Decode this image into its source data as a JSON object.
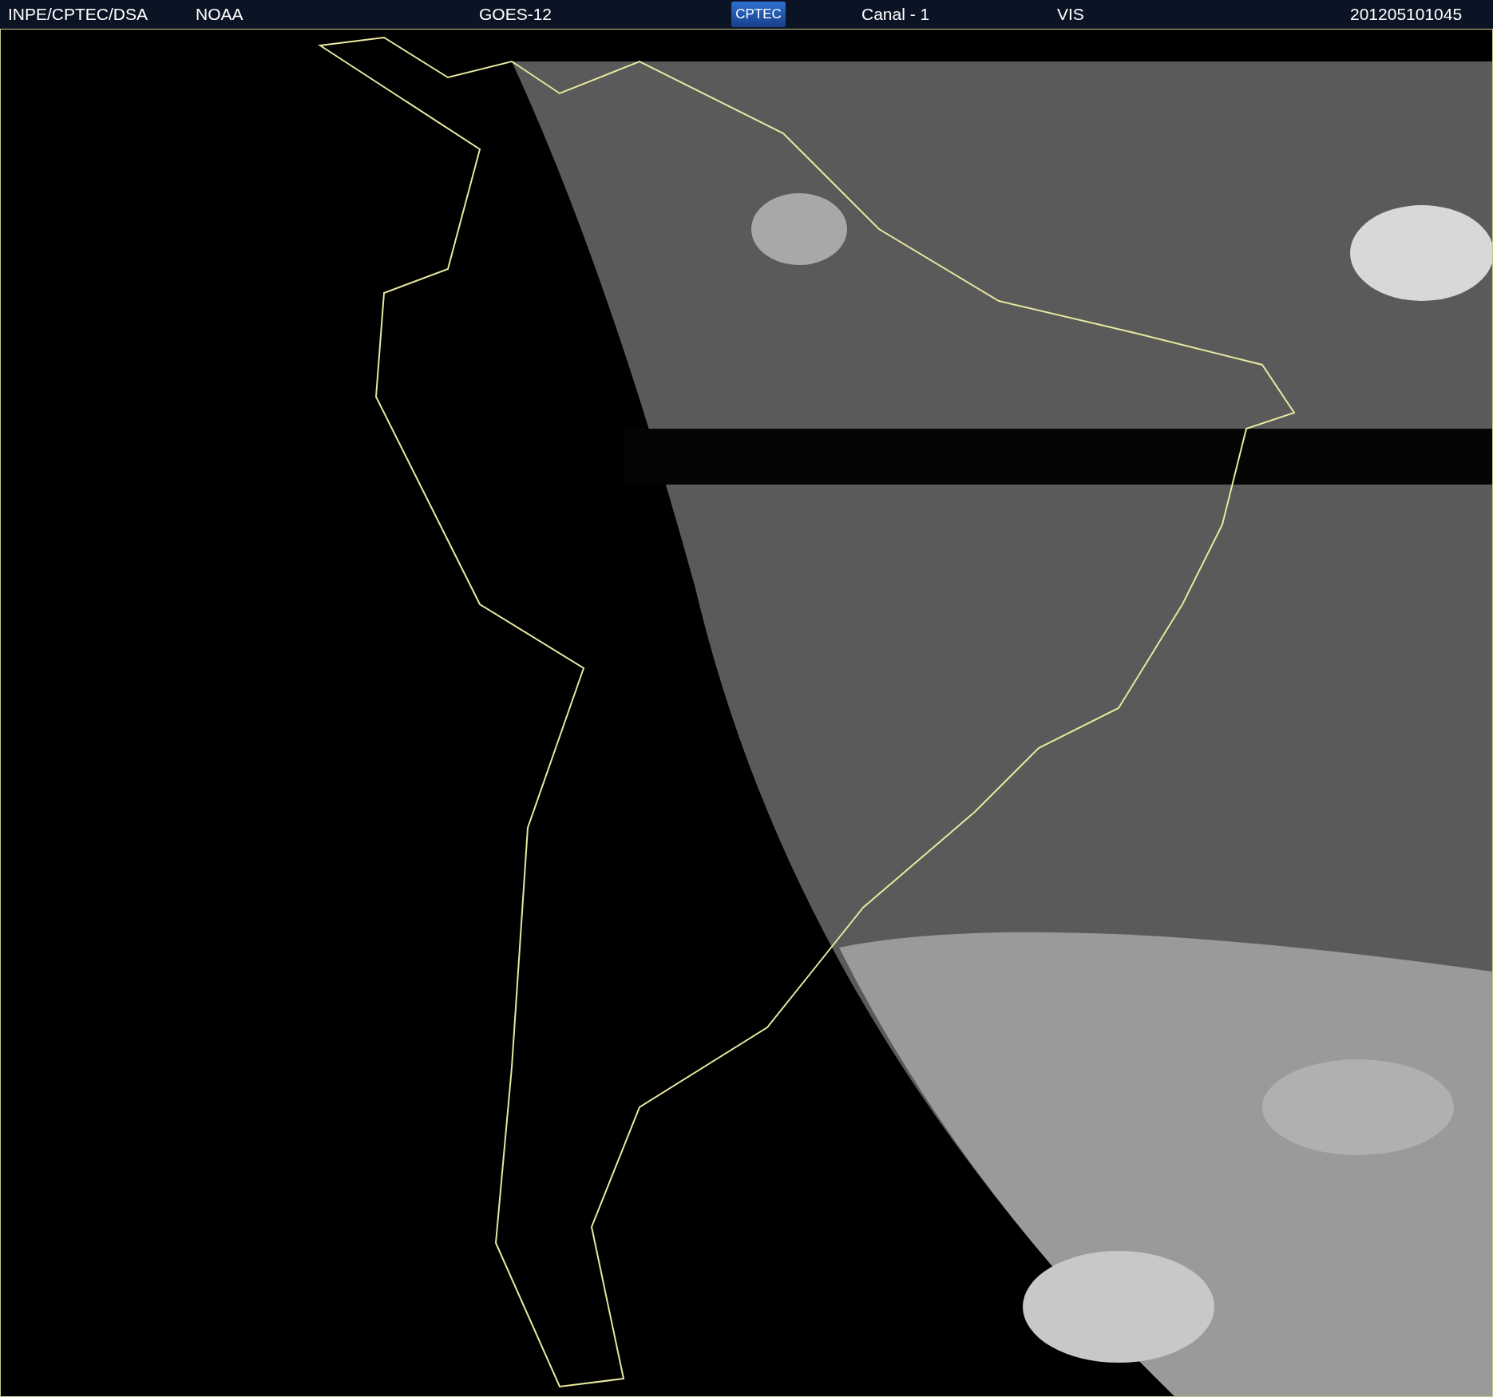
{
  "header": [
    {
      "kind": "text",
      "text": "INPE/CPTEC/DSA"
    },
    {
      "kind": "text",
      "text": "NOAA"
    },
    {
      "kind": "text",
      "text": "GOES-12"
    },
    {
      "kind": "logo",
      "text": "CPTEC"
    },
    {
      "kind": "text",
      "text": "Canal - 1"
    },
    {
      "kind": "text",
      "text": "VIS"
    },
    {
      "kind": "text",
      "text": "201205101045"
    }
  ]
}
